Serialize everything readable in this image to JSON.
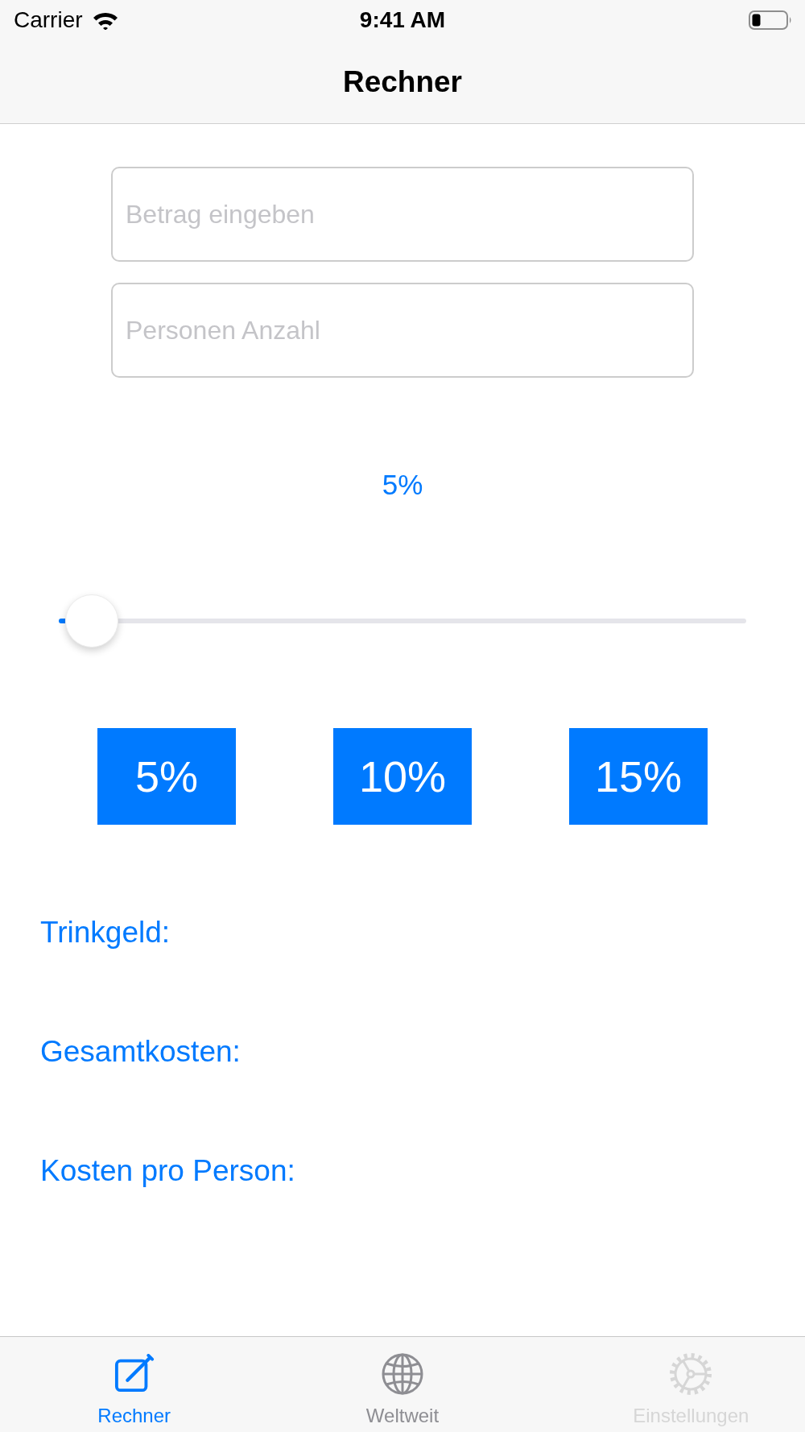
{
  "status_bar": {
    "carrier": "Carrier",
    "time": "9:41 AM"
  },
  "nav_bar": {
    "title": "Rechner"
  },
  "fields": [
    {
      "placeholder": "Betrag eingeben"
    },
    {
      "placeholder": "Personen Anzahl"
    }
  ],
  "tip_label": "5%",
  "slider": {
    "level": 0.01
  },
  "tip_buttons": [
    "5%",
    "10%",
    "15%"
  ],
  "results": [
    {
      "label": "Trinkgeld:"
    },
    {
      "label": "Gesamtkosten:"
    },
    {
      "label": "Kosten pro Person:"
    }
  ],
  "tab_bar": [
    {
      "label": "Rechner",
      "selected": true,
      "disabled": false
    },
    {
      "label": "Weltweit",
      "selected": false,
      "disabled": false
    },
    {
      "label": "Einstellungen",
      "selected": false,
      "disabled": true
    }
  ]
}
